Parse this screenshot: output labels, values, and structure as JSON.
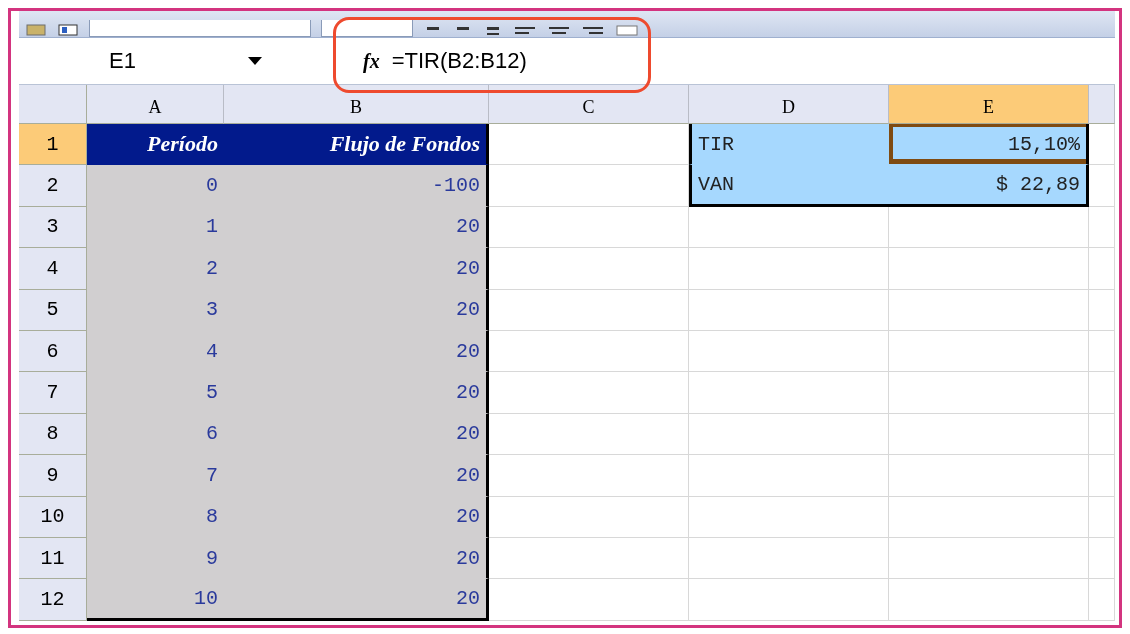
{
  "formula_bar": {
    "name_box": "E1",
    "function_label": "fx",
    "formula": "=TIR(B2:B12)",
    "highlighted": true
  },
  "columns": [
    {
      "label": "A",
      "selected": false
    },
    {
      "label": "B",
      "selected": false
    },
    {
      "label": "C",
      "selected": false
    },
    {
      "label": "D",
      "selected": false
    },
    {
      "label": "E",
      "selected": true
    }
  ],
  "rows": [
    {
      "label": "1",
      "selected": true,
      "cells": [
        {
          "kind": "title",
          "text": "Período",
          "active": false
        },
        {
          "kind": "title",
          "text": "Flujo de Fondos",
          "active": false
        },
        {
          "kind": "empty",
          "active": false
        },
        {
          "kind": "result_label",
          "text": "TIR",
          "active": false
        },
        {
          "kind": "result_value",
          "text": "15,10%",
          "active": true
        }
      ]
    },
    {
      "label": "2",
      "selected": false,
      "cells": [
        {
          "kind": "data",
          "text": "0",
          "active": false
        },
        {
          "kind": "data",
          "text": "-100",
          "active": false
        },
        {
          "kind": "empty",
          "active": false
        },
        {
          "kind": "result_label",
          "text": "VAN",
          "active": false
        },
        {
          "kind": "result_value",
          "text": "$ 22,89",
          "active": false
        }
      ]
    },
    {
      "label": "3",
      "selected": false,
      "cells": [
        {
          "kind": "data",
          "text": "1",
          "active": false
        },
        {
          "kind": "data",
          "text": "20",
          "active": false
        },
        {
          "kind": "empty",
          "active": false
        },
        {
          "kind": "empty",
          "active": false
        },
        {
          "kind": "empty",
          "active": false
        }
      ]
    },
    {
      "label": "4",
      "selected": false,
      "cells": [
        {
          "kind": "data",
          "text": "2",
          "active": false
        },
        {
          "kind": "data",
          "text": "20",
          "active": false
        },
        {
          "kind": "empty",
          "active": false
        },
        {
          "kind": "empty",
          "active": false
        },
        {
          "kind": "empty",
          "active": false
        }
      ]
    },
    {
      "label": "5",
      "selected": false,
      "cells": [
        {
          "kind": "data",
          "text": "3",
          "active": false
        },
        {
          "kind": "data",
          "text": "20",
          "active": false
        },
        {
          "kind": "empty",
          "active": false
        },
        {
          "kind": "empty",
          "active": false
        },
        {
          "kind": "empty",
          "active": false
        }
      ]
    },
    {
      "label": "6",
      "selected": false,
      "cells": [
        {
          "kind": "data",
          "text": "4",
          "active": false
        },
        {
          "kind": "data",
          "text": "20",
          "active": false
        },
        {
          "kind": "empty",
          "active": false
        },
        {
          "kind": "empty",
          "active": false
        },
        {
          "kind": "empty",
          "active": false
        }
      ]
    },
    {
      "label": "7",
      "selected": false,
      "cells": [
        {
          "kind": "data",
          "text": "5",
          "active": false
        },
        {
          "kind": "data",
          "text": "20",
          "active": false
        },
        {
          "kind": "empty",
          "active": false
        },
        {
          "kind": "empty",
          "active": false
        },
        {
          "kind": "empty",
          "active": false
        }
      ]
    },
    {
      "label": "8",
      "selected": false,
      "cells": [
        {
          "kind": "data",
          "text": "6",
          "active": false
        },
        {
          "kind": "data",
          "text": "20",
          "active": false
        },
        {
          "kind": "empty",
          "active": false
        },
        {
          "kind": "empty",
          "active": false
        },
        {
          "kind": "empty",
          "active": false
        }
      ]
    },
    {
      "label": "9",
      "selected": false,
      "cells": [
        {
          "kind": "data",
          "text": "7",
          "active": false
        },
        {
          "kind": "data",
          "text": "20",
          "active": false
        },
        {
          "kind": "empty",
          "active": false
        },
        {
          "kind": "empty",
          "active": false
        },
        {
          "kind": "empty",
          "active": false
        }
      ]
    },
    {
      "label": "10",
      "selected": false,
      "cells": [
        {
          "kind": "data",
          "text": "8",
          "active": false
        },
        {
          "kind": "data",
          "text": "20",
          "active": false
        },
        {
          "kind": "empty",
          "active": false
        },
        {
          "kind": "empty",
          "active": false
        },
        {
          "kind": "empty",
          "active": false
        }
      ]
    },
    {
      "label": "11",
      "selected": false,
      "cells": [
        {
          "kind": "data",
          "text": "9",
          "active": false
        },
        {
          "kind": "data",
          "text": "20",
          "active": false
        },
        {
          "kind": "empty",
          "active": false
        },
        {
          "kind": "empty",
          "active": false
        },
        {
          "kind": "empty",
          "active": false
        }
      ]
    },
    {
      "label": "12",
      "selected": false,
      "cells": [
        {
          "kind": "data",
          "text": "10",
          "active": false
        },
        {
          "kind": "data",
          "text": "20",
          "active": false
        },
        {
          "kind": "empty",
          "active": false
        },
        {
          "kind": "empty",
          "active": false
        },
        {
          "kind": "empty",
          "active": false
        }
      ]
    }
  ]
}
